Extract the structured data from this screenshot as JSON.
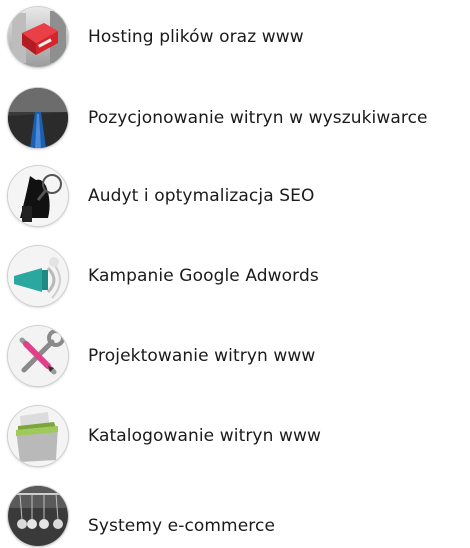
{
  "services": [
    {
      "label": "Hosting plików oraz www",
      "icon": "server-hosting-icon"
    },
    {
      "label": "Pozycjonowanie witryn w wyszukiwarce",
      "icon": "road-ranking-icon"
    },
    {
      "label": "Audyt i optymalizacja SEO",
      "icon": "magnifier-audit-icon"
    },
    {
      "label": "Kampanie Google Adwords",
      "icon": "megaphone-ads-icon"
    },
    {
      "label": "Projektowanie witryn www",
      "icon": "tools-design-icon"
    },
    {
      "label": "Katalogowanie witryn www",
      "icon": "folder-catalog-icon"
    },
    {
      "label": "Systemy e-commerce",
      "icon": "newton-cradle-icon"
    }
  ],
  "colors": {
    "text": "#1a1a1a",
    "hosting_red": "#d8232a",
    "road_blue": "#1b5fae",
    "ads_teal": "#2aa8a0",
    "pencil_pink": "#e0408a",
    "folder_green": "#7aa53a"
  }
}
